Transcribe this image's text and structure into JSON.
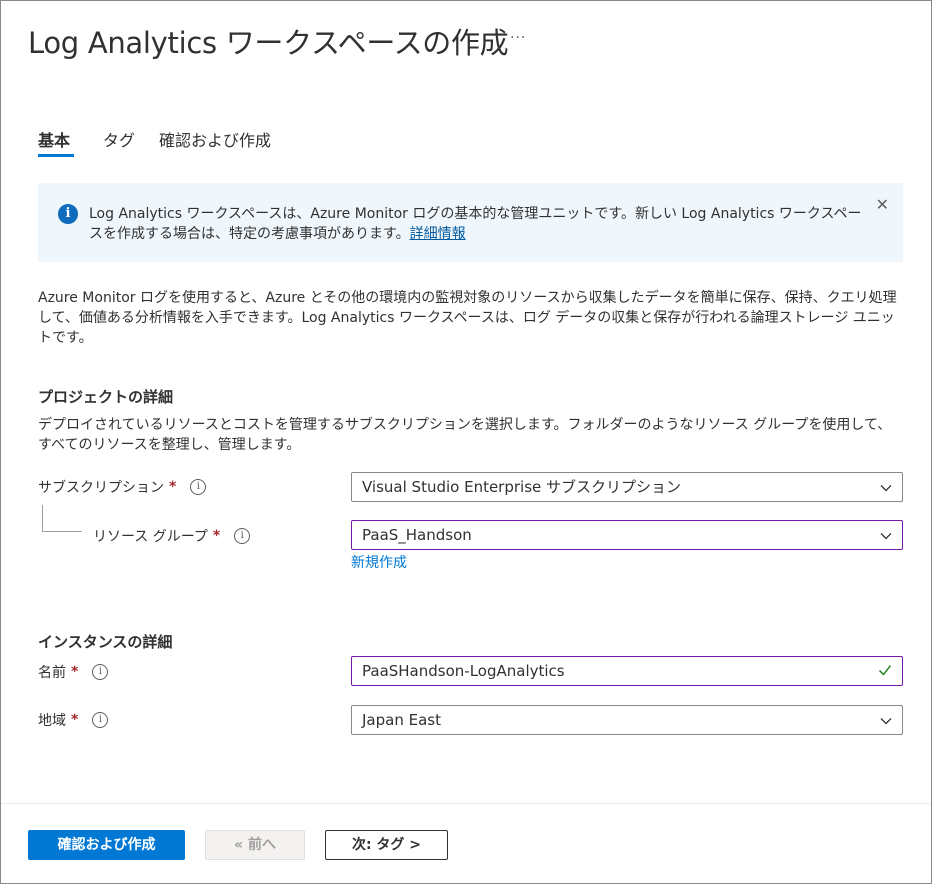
{
  "header": {
    "title": "Log Analytics ワークスペースの作成",
    "more": "···"
  },
  "tabs": [
    {
      "label": "基本",
      "active": true
    },
    {
      "label": "タグ",
      "active": false
    },
    {
      "label": "確認および作成",
      "active": false
    }
  ],
  "info": {
    "icon": "info-icon",
    "text": "Log Analytics ワークスペースは、Azure Monitor ログの基本的な管理ユニットです。新しい Log Analytics ワークスペースを作成する場合は、特定の考慮事項があります。",
    "link": "詳細情報",
    "close": "✕"
  },
  "description": "Azure Monitor ログを使用すると、Azure とその他の環境内の監視対象のリソースから収集したデータを簡単に保存、保持、クエリ処理して、価値ある分析情報を入手できます。Log Analytics ワークスペースは、ログ データの収集と保存が行われる論理ストレージ ユニットです。",
  "project": {
    "heading": "プロジェクトの詳細",
    "description": "デプロイされているリソースとコストを管理するサブスクリプションを選択します。フォルダーのようなリソース グループを使用して、すべてのリソースを整理し、管理します。",
    "subscription": {
      "label": "サブスクリプション",
      "required": "*",
      "value": "Visual Studio Enterprise サブスクリプション"
    },
    "resource_group": {
      "label": "リソース グループ",
      "required": "*",
      "value": "PaaS_Handson",
      "new_link": "新規作成"
    }
  },
  "instance": {
    "heading": "インスタンスの詳細",
    "name": {
      "label": "名前",
      "required": "*",
      "value": "PaaSHandson-LogAnalytics"
    },
    "region": {
      "label": "地域",
      "required": "*",
      "value": "Japan East"
    }
  },
  "info_glyph": "i",
  "footer": {
    "review_create": "確認および作成",
    "previous": "« 前へ",
    "next": "次: タグ >"
  },
  "colors": {
    "accent": "#0078d4",
    "focus_border": "#7719aa",
    "required": "#a4262c",
    "valid": "#107c10"
  }
}
